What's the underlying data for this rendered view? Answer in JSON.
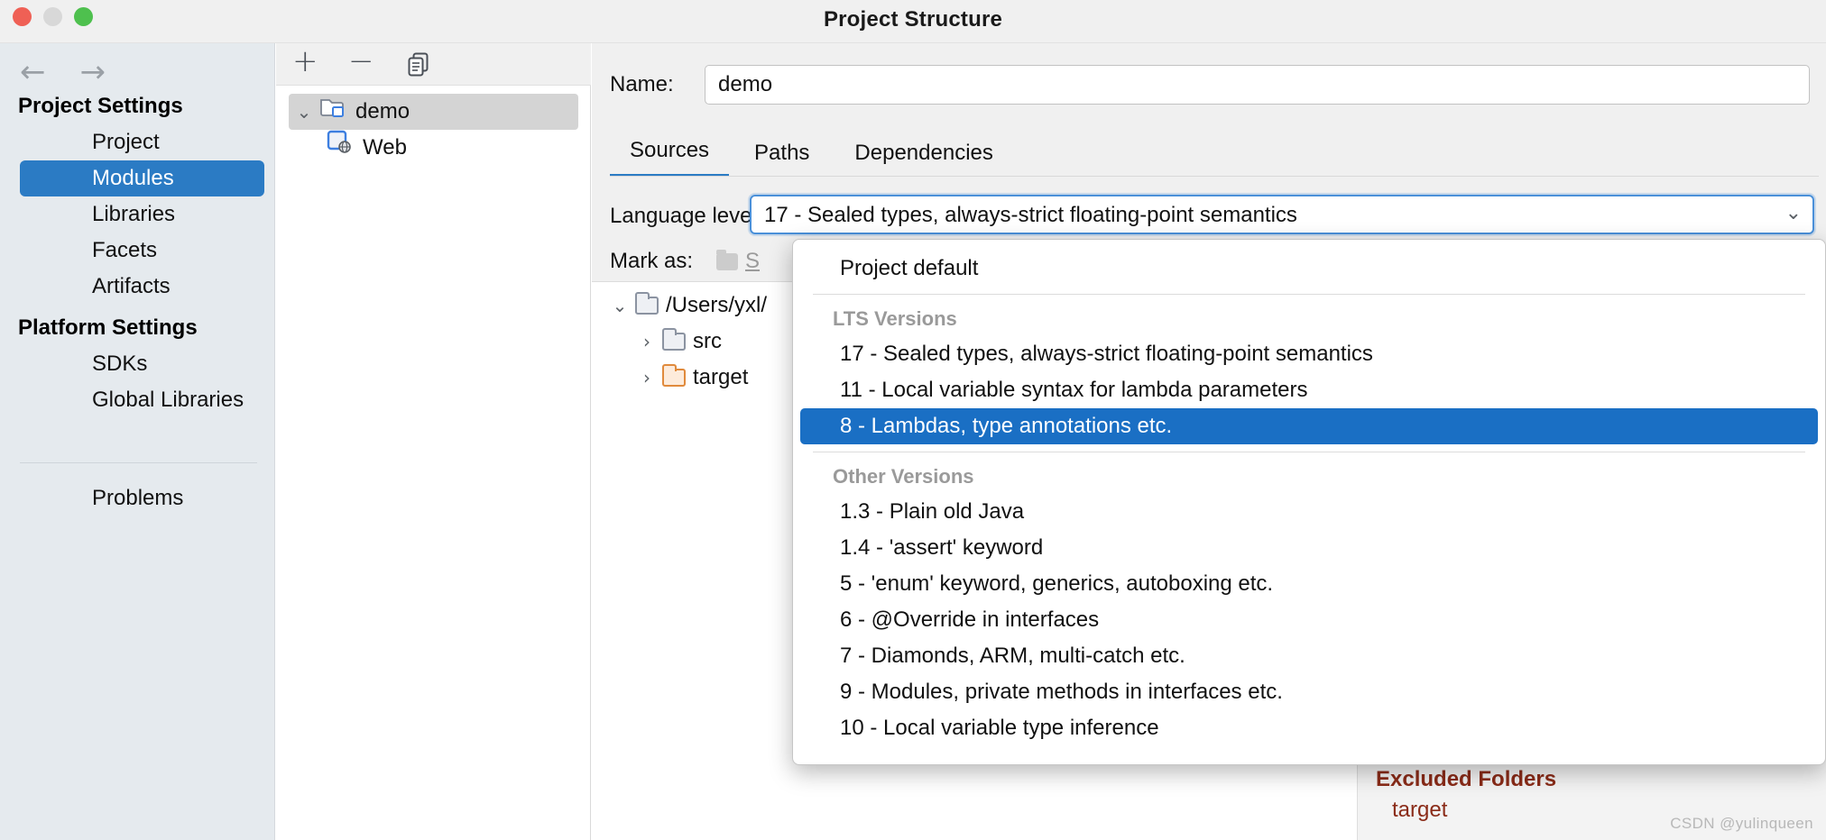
{
  "window": {
    "title": "Project Structure",
    "traffic_lights": [
      "close-button",
      "minimize-button",
      "zoom-button"
    ]
  },
  "sidebar": {
    "back_arrow": "←",
    "forward_arrow": "→",
    "groups": [
      {
        "title": "Project Settings",
        "items": [
          {
            "label": "Project",
            "selected": false
          },
          {
            "label": "Modules",
            "selected": true
          },
          {
            "label": "Libraries",
            "selected": false
          },
          {
            "label": "Facets",
            "selected": false
          },
          {
            "label": "Artifacts",
            "selected": false
          }
        ]
      },
      {
        "title": "Platform Settings",
        "items": [
          {
            "label": "SDKs",
            "selected": false
          },
          {
            "label": "Global Libraries",
            "selected": false
          }
        ]
      }
    ],
    "footer_items": [
      {
        "label": "Problems",
        "selected": false
      }
    ]
  },
  "modules_panel": {
    "toolbar": {
      "add_label": "+",
      "remove_label": "−",
      "copy_label": "⎘"
    },
    "tree": [
      {
        "label": "demo",
        "chevron": "⌄",
        "icon": "module-folder-icon",
        "selected": true,
        "indent": 0
      },
      {
        "label": "Web",
        "chevron": "",
        "icon": "web-facet-icon",
        "selected": false,
        "indent": 1
      }
    ]
  },
  "content": {
    "name_label": "Name:",
    "name_value": "demo",
    "tabs": [
      {
        "label": "Sources",
        "active": true
      },
      {
        "label": "Paths",
        "active": false
      },
      {
        "label": "Dependencies",
        "active": false
      }
    ],
    "language_level_label": "Language level:",
    "language_level_value": "17 - Sealed types, always-strict floating-point semantics",
    "combo_chevron": "⌄",
    "mark_as_label": "Mark as:",
    "mark_as_chip": "S",
    "source_tree": [
      {
        "label": "/Users/yxl/",
        "chevron": "⌄",
        "color": "grey",
        "indent": 0
      },
      {
        "label": "src",
        "chevron": "›",
        "color": "grey",
        "indent": 1
      },
      {
        "label": "target",
        "chevron": "›",
        "color": "orange",
        "indent": 1
      }
    ],
    "excluded_panel": {
      "title": "Excluded Folders",
      "items": [
        "target"
      ]
    }
  },
  "dropdown": {
    "entries": [
      {
        "type": "item",
        "label": "Project default",
        "highlight": false
      },
      {
        "type": "sep",
        "label": ""
      },
      {
        "type": "header",
        "label": "LTS Versions"
      },
      {
        "type": "item",
        "label": "17 - Sealed types, always-strict floating-point semantics",
        "highlight": false
      },
      {
        "type": "item",
        "label": "11 - Local variable syntax for lambda parameters",
        "highlight": false
      },
      {
        "type": "item",
        "label": "8 - Lambdas, type annotations etc.",
        "highlight": true
      },
      {
        "type": "sep",
        "label": ""
      },
      {
        "type": "header",
        "label": "Other Versions"
      },
      {
        "type": "item",
        "label": "1.3 - Plain old Java",
        "highlight": false
      },
      {
        "type": "item",
        "label": "1.4 - 'assert' keyword",
        "highlight": false
      },
      {
        "type": "item",
        "label": "5 - 'enum' keyword, generics, autoboxing etc.",
        "highlight": false
      },
      {
        "type": "item",
        "label": "6 - @Override in interfaces",
        "highlight": false
      },
      {
        "type": "item",
        "label": "7 - Diamonds, ARM, multi-catch etc.",
        "highlight": false
      },
      {
        "type": "item",
        "label": "9 - Modules, private methods in interfaces etc.",
        "highlight": false
      },
      {
        "type": "item",
        "label": "10 - Local variable type inference",
        "highlight": false
      }
    ]
  },
  "watermark": "CSDN @yulinqueen",
  "colors": {
    "accent": "#2b7bc4",
    "highlight": "#1a6fc4",
    "sidebar_bg": "#e5eaee",
    "excluded_text": "#8a2b18"
  }
}
